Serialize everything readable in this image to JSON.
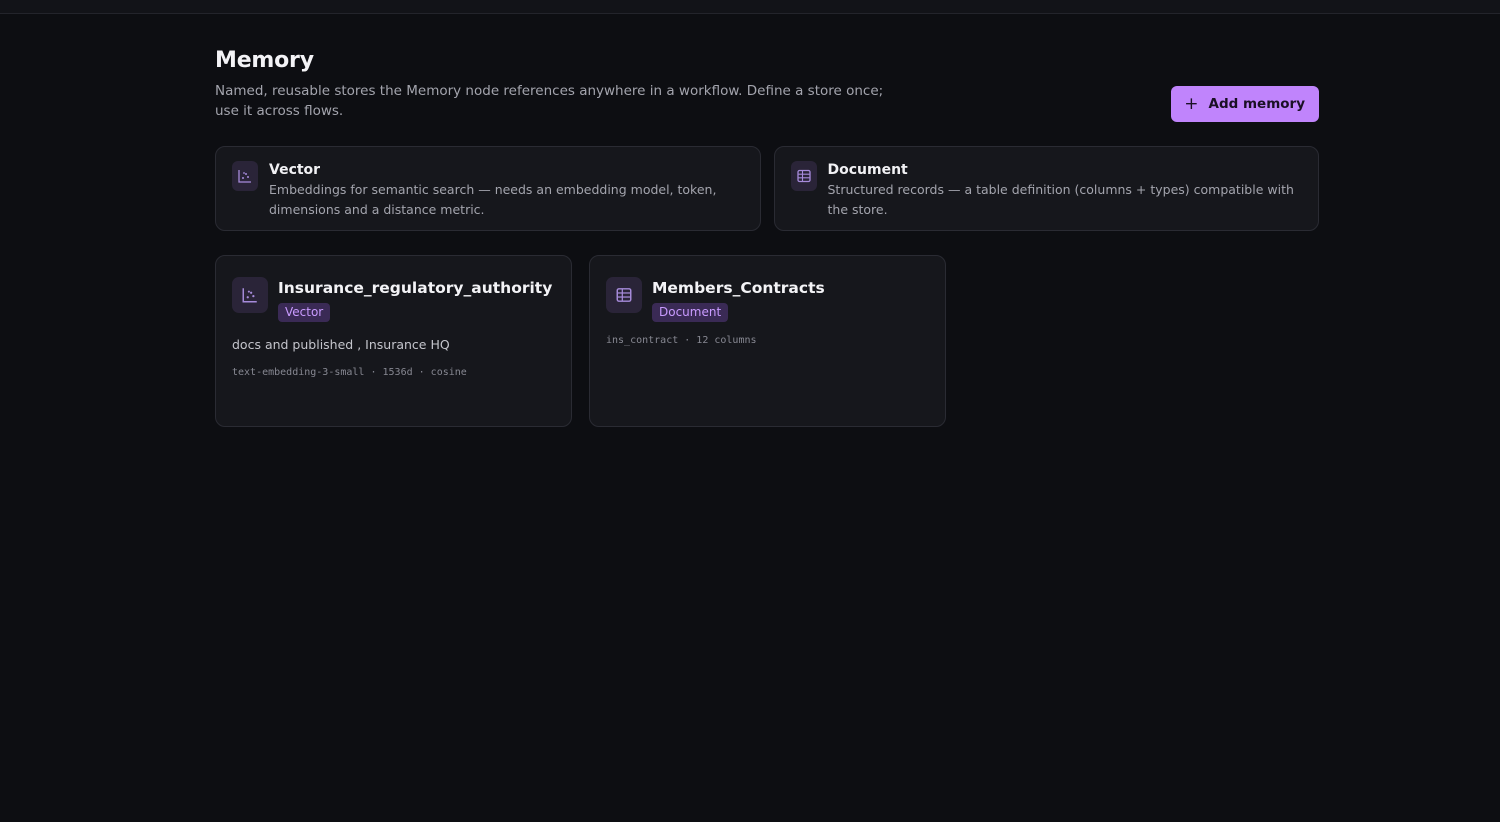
{
  "header": {
    "title": "Memory",
    "description": "Named, reusable stores the Memory node references anywhere in a workflow. Define a store once; use it across flows.",
    "add_button_icon": "plus-icon",
    "add_button_label": "Add memory"
  },
  "types": [
    {
      "icon": "scatter-chart-icon",
      "name": "Vector",
      "description": "Embeddings for semantic search — needs an embedding model, token, dimensions and a distance metric."
    },
    {
      "icon": "table-icon",
      "name": "Document",
      "description": "Structured records — a table definition (columns + types) compatible with the store."
    }
  ],
  "stores": [
    {
      "icon": "scatter-chart-icon",
      "name": "Insurance_regulatory_authority",
      "badge": "Vector",
      "description": "docs and published , Insurance HQ",
      "meta": "text-embedding-3-small · 1536d · cosine"
    },
    {
      "icon": "table-icon",
      "name": "Members_Contracts",
      "badge": "Document",
      "meta": "ins_contract · 12 columns"
    }
  ],
  "colors": {
    "accent": "#c084fc",
    "background": "#0d0e12",
    "card": "#16171c",
    "badge_bg": "#3a2a55",
    "badge_text": "#c99bff"
  }
}
